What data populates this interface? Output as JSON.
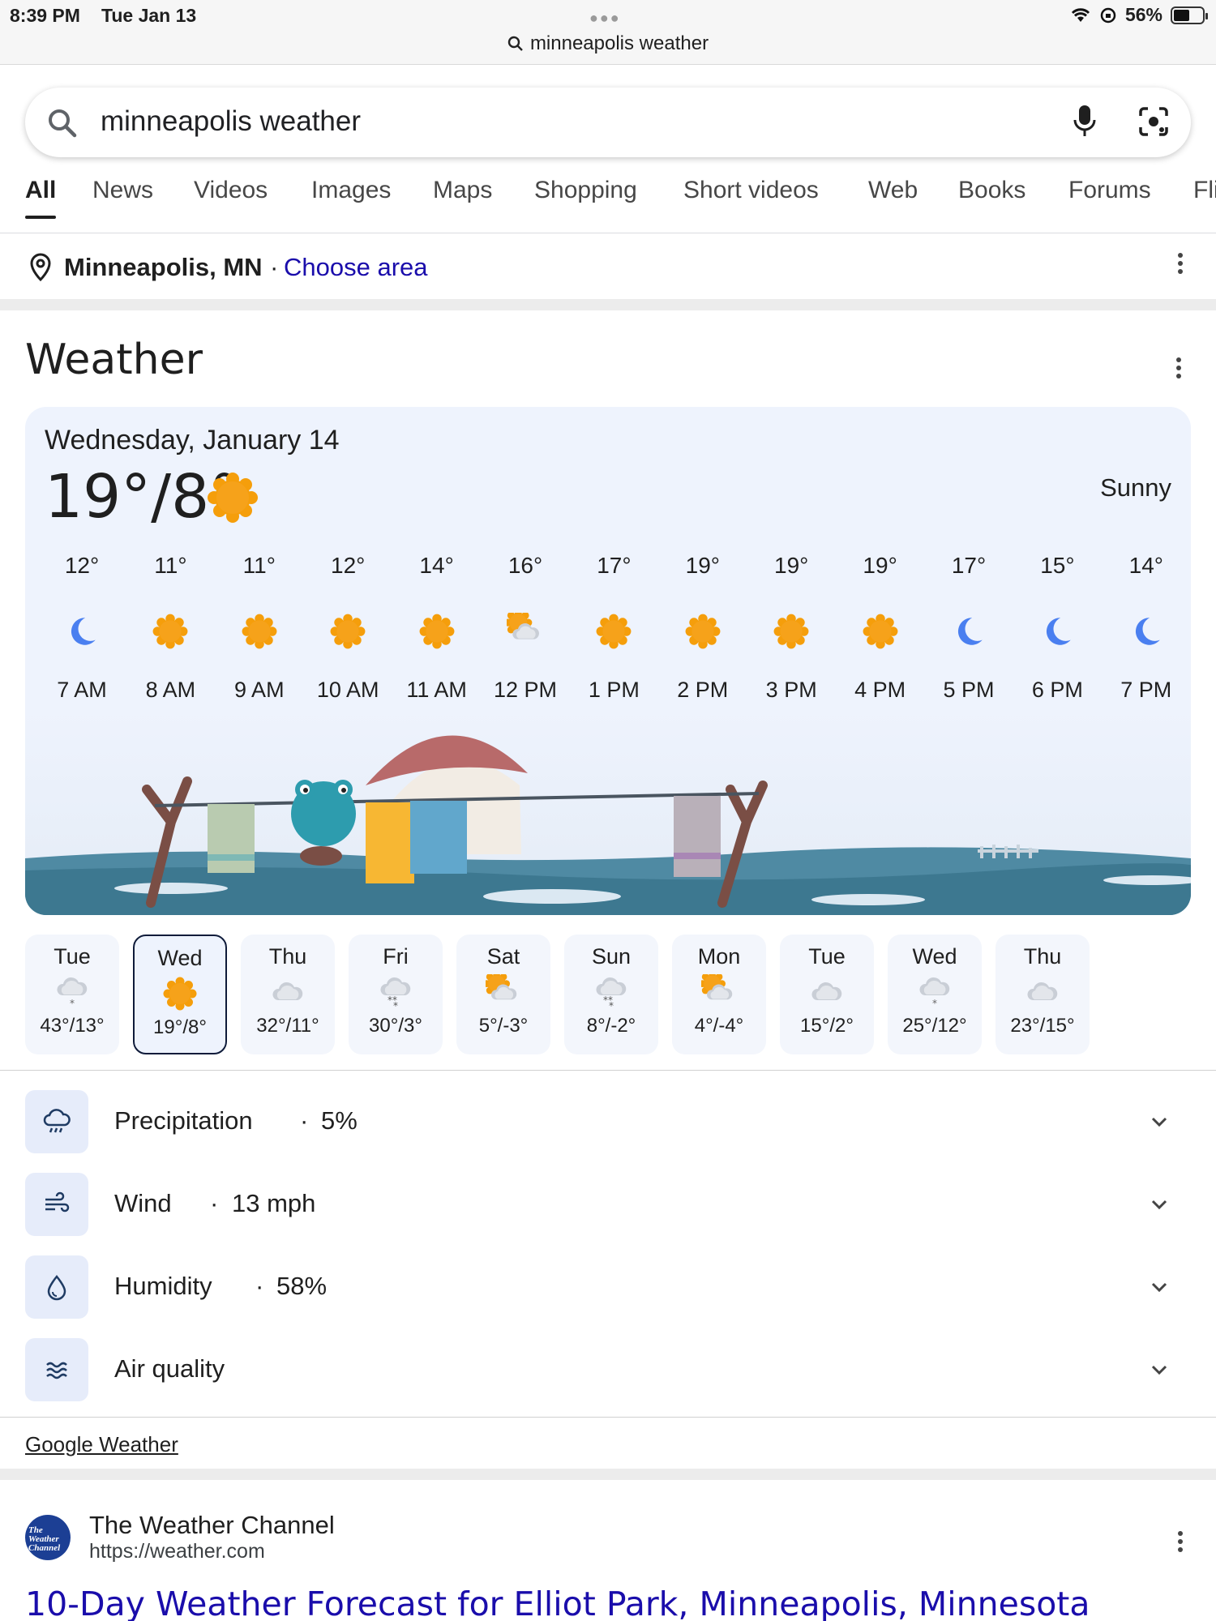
{
  "status_bar": {
    "time": "8:39 PM",
    "date": "Tue Jan 13",
    "battery": "56%",
    "battery_level": 0.56,
    "url": "minneapolis weather"
  },
  "search": {
    "query": "minneapolis weather",
    "icons": [
      "search-icon",
      "mic-icon",
      "lens-icon"
    ]
  },
  "tabs": [
    {
      "label": "All",
      "active": true
    },
    {
      "label": "News"
    },
    {
      "label": "Videos"
    },
    {
      "label": "Images"
    },
    {
      "label": "Maps"
    },
    {
      "label": "Shopping"
    },
    {
      "label": "Short videos"
    },
    {
      "label": "Web"
    },
    {
      "label": "Books"
    },
    {
      "label": "Forums"
    },
    {
      "label": "Fli"
    }
  ],
  "location": {
    "name": "Minneapolis, MN",
    "separator": "·",
    "action": "Choose area"
  },
  "weather": {
    "title": "Weather",
    "date": "Wednesday, January 14",
    "temp": "19°/8°",
    "condition": "Sunny",
    "hourly": [
      {
        "temp": "12°",
        "icon": "moon-icon",
        "time": "7 AM"
      },
      {
        "temp": "11°",
        "icon": "sun-icon",
        "time": "8 AM"
      },
      {
        "temp": "11°",
        "icon": "sun-icon",
        "time": "9 AM"
      },
      {
        "temp": "12°",
        "icon": "sun-icon",
        "time": "10 AM"
      },
      {
        "temp": "14°",
        "icon": "sun-icon",
        "time": "11 AM"
      },
      {
        "temp": "16°",
        "icon": "partly-cloudy-icon",
        "time": "12 PM"
      },
      {
        "temp": "17°",
        "icon": "sun-icon",
        "time": "1 PM"
      },
      {
        "temp": "19°",
        "icon": "sun-icon",
        "time": "2 PM"
      },
      {
        "temp": "19°",
        "icon": "sun-icon",
        "time": "3 PM"
      },
      {
        "temp": "19°",
        "icon": "sun-icon",
        "time": "4 PM"
      },
      {
        "temp": "17°",
        "icon": "moon-icon",
        "time": "5 PM"
      },
      {
        "temp": "15°",
        "icon": "moon-icon",
        "time": "6 PM"
      },
      {
        "temp": "14°",
        "icon": "moon-icon",
        "time": "7 PM"
      }
    ],
    "daily": [
      {
        "day": "Tue",
        "icon": "snow-cloud-icon",
        "temps": "43°/13°"
      },
      {
        "day": "Wed",
        "icon": "sun-icon",
        "temps": "19°/8°",
        "selected": true
      },
      {
        "day": "Thu",
        "icon": "cloud-icon",
        "temps": "32°/11°"
      },
      {
        "day": "Fri",
        "icon": "snow-heavy-icon",
        "temps": "30°/3°"
      },
      {
        "day": "Sat",
        "icon": "partly-cloudy-icon",
        "temps": "5°/-3°"
      },
      {
        "day": "Sun",
        "icon": "snow-heavy-icon",
        "temps": "8°/-2°"
      },
      {
        "day": "Mon",
        "icon": "partly-cloudy-icon",
        "temps": "4°/-4°"
      },
      {
        "day": "Tue",
        "icon": "cloud-icon",
        "temps": "15°/2°"
      },
      {
        "day": "Wed",
        "icon": "snow-cloud-icon",
        "temps": "25°/12°"
      },
      {
        "day": "Thu",
        "icon": "cloud-icon",
        "temps": "23°/15°"
      }
    ],
    "details": [
      {
        "label": "Precipitation",
        "value": "5%",
        "icon": "rain-cloud-icon"
      },
      {
        "label": "Wind",
        "value": "13 mph",
        "icon": "wind-icon"
      },
      {
        "label": "Humidity",
        "value": "58%",
        "icon": "droplet-icon"
      },
      {
        "label": "Air quality",
        "value": "",
        "icon": "air-quality-icon"
      }
    ],
    "dot": "·",
    "source_link": "Google Weather"
  },
  "result": {
    "logo_text": "The Weather Channel",
    "site": "The Weather Channel",
    "url": "https://weather.com",
    "title": "10-Day Weather Forecast for Elliot Park, Minneapolis, Minnesota"
  },
  "colors": {
    "link": "#1a0dab",
    "sun": "#f59e0b",
    "moon": "#4a7ff0",
    "card_bg": "#eef3fd"
  }
}
